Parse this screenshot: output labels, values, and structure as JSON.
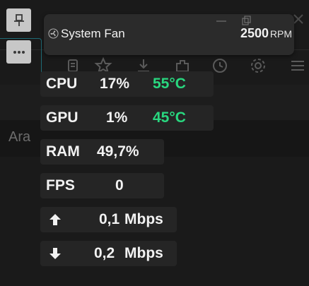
{
  "background": {
    "search_placeholder": "Ara"
  },
  "side_buttons": [
    {
      "icon": "pin-icon"
    },
    {
      "icon": "more-icon"
    }
  ],
  "fan": {
    "label": "System Fan",
    "value": "2500",
    "unit": "RPM"
  },
  "stats": {
    "cpu": {
      "label": "CPU",
      "usage": "17%",
      "temp": "55°C"
    },
    "gpu": {
      "label": "GPU",
      "usage": "1%",
      "temp": "45°C"
    },
    "ram": {
      "label": "RAM",
      "usage": "49,7%"
    },
    "fps": {
      "label": "FPS",
      "value": "0"
    },
    "upload": {
      "value": "0,1",
      "unit": "Mbps"
    },
    "download": {
      "value": "0,2",
      "unit": "Mbps"
    }
  },
  "colors": {
    "temp_accent": "#29d77f",
    "card_bg": "#252525"
  }
}
